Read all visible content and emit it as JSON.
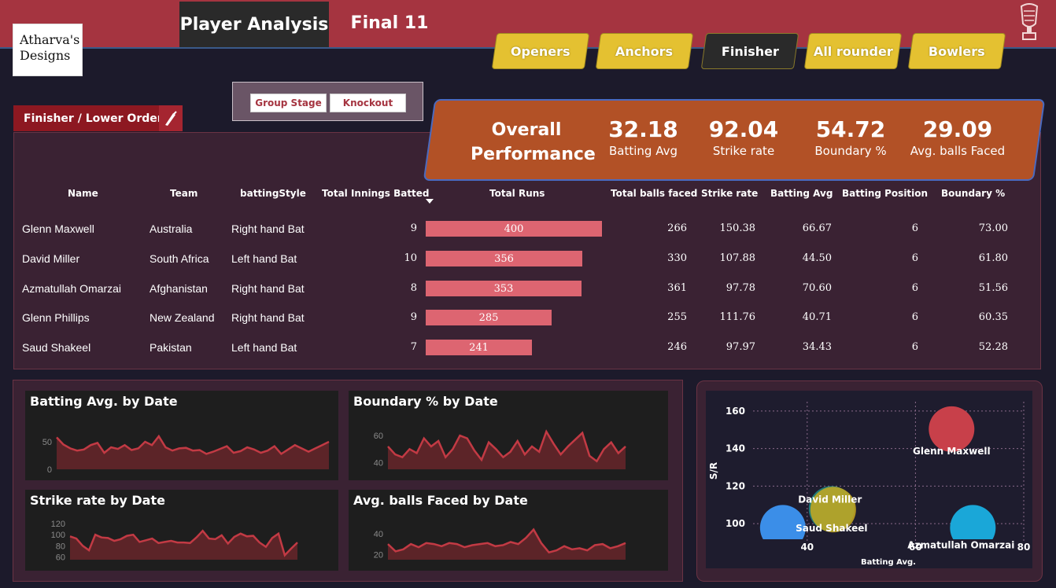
{
  "header": {
    "active_tab": "Player Analysis",
    "second_tab": "Final 11",
    "logo_text_line1": "Atharva's",
    "logo_text_line2": "Designs"
  },
  "nav": {
    "items": [
      {
        "label": "Openers",
        "active": false
      },
      {
        "label": "Anchors",
        "active": false
      },
      {
        "label": "Finisher",
        "active": true
      },
      {
        "label": "All rounder",
        "active": false
      },
      {
        "label": "Bowlers",
        "active": false
      }
    ]
  },
  "slicer": {
    "options": [
      "Group Stage",
      "Knockout"
    ]
  },
  "section_label": "Finisher / Lower Order",
  "kpi": {
    "title_line1": "Overall",
    "title_line2": "Performance",
    "items": [
      {
        "value": "32.18",
        "label": "Batting Avg"
      },
      {
        "value": "92.04",
        "label": "Strike rate"
      },
      {
        "value": "54.72",
        "label": "Boundary %"
      },
      {
        "value": "29.09",
        "label": "Avg. balls Faced"
      }
    ]
  },
  "table": {
    "columns": [
      "Name",
      "Team",
      "battingStyle",
      "Total Innings Batted",
      "Total Runs",
      "Total balls faced",
      "Strike rate",
      "Batting Avg",
      "Batting Position",
      "Boundary %"
    ],
    "rows": [
      {
        "name": "Glenn Maxwell",
        "team": "Australia",
        "style": "Right hand Bat",
        "innings": "9",
        "runs": 400,
        "balls": "266",
        "sr": "150.38",
        "avg": "66.67",
        "pos": "6",
        "boundary": "73.00"
      },
      {
        "name": "David Miller",
        "team": "South Africa",
        "style": "Left hand Bat",
        "innings": "10",
        "runs": 356,
        "balls": "330",
        "sr": "107.88",
        "avg": "44.50",
        "pos": "6",
        "boundary": "61.80"
      },
      {
        "name": "Azmatullah Omarzai",
        "team": "Afghanistan",
        "style": "Right hand Bat",
        "innings": "8",
        "runs": 353,
        "balls": "361",
        "sr": "97.78",
        "avg": "70.60",
        "pos": "6",
        "boundary": "51.56"
      },
      {
        "name": "Glenn Phillips",
        "team": "New Zealand",
        "style": "Right hand Bat",
        "innings": "9",
        "runs": 285,
        "balls": "255",
        "sr": "111.76",
        "avg": "40.71",
        "pos": "6",
        "boundary": "60.35"
      },
      {
        "name": "Saud Shakeel",
        "team": "Pakistan",
        "style": "Left hand Bat",
        "innings": "7",
        "runs": 241,
        "balls": "246",
        "sr": "97.97",
        "avg": "34.43",
        "pos": "6",
        "boundary": "52.28"
      }
    ],
    "runs_max": 400
  },
  "chart_data": [
    {
      "type": "area",
      "title": "Batting Avg. by Date",
      "ylim": [
        0,
        80
      ],
      "yticks": [
        "50",
        "0"
      ],
      "ytick_values": [
        50,
        0
      ],
      "values": [
        58,
        45,
        38,
        34,
        36,
        44,
        48,
        30,
        40,
        37,
        44,
        35,
        38,
        50,
        44,
        60,
        40,
        34,
        38,
        39,
        34,
        35,
        28,
        32,
        37,
        42,
        30,
        33,
        40,
        36,
        30,
        34,
        42,
        28,
        36,
        44,
        38,
        32,
        38,
        44,
        50
      ]
    },
    {
      "type": "area",
      "title": "Boundary % by Date",
      "ylim": [
        35,
        70
      ],
      "yticks": [
        "60",
        "40"
      ],
      "ytick_values": [
        60,
        40
      ],
      "values": [
        52,
        46,
        44,
        50,
        47,
        58,
        52,
        56,
        44,
        50,
        60,
        58,
        49,
        42,
        55,
        50,
        44,
        48,
        56,
        46,
        52,
        48,
        63,
        54,
        46,
        52,
        57,
        62,
        45,
        41,
        50,
        55,
        47,
        52
      ]
    },
    {
      "type": "area",
      "title": "Strike rate by Date",
      "ylim": [
        55,
        130
      ],
      "yticks": [
        "120",
        "100",
        "80",
        "60"
      ],
      "ytick_values": [
        120,
        100,
        80,
        60
      ],
      "values": [
        97,
        93,
        80,
        72,
        100,
        95,
        94,
        89,
        92,
        98,
        100,
        87,
        90,
        93,
        85,
        87,
        89,
        86,
        86,
        85,
        95,
        107,
        93,
        92,
        99,
        84,
        96,
        102,
        97,
        98,
        86,
        78,
        94,
        102,
        63,
        75,
        86
      ]
    },
    {
      "type": "area",
      "title": "Avg. balls Faced by Date",
      "ylim": [
        15,
        55
      ],
      "yticks": [
        "40",
        "20"
      ],
      "ytick_values": [
        40,
        20
      ],
      "values": [
        30,
        23,
        25,
        30,
        27,
        31,
        30,
        28,
        31,
        30,
        27,
        29,
        30,
        31,
        28,
        29,
        32,
        30,
        36,
        44,
        31,
        22,
        24,
        28,
        25,
        26,
        24,
        29,
        30,
        26,
        28,
        31
      ]
    },
    {
      "type": "scatter",
      "xlabel": "Batting Avg.",
      "ylabel": "S/R",
      "xlim": [
        30,
        80
      ],
      "ylim": [
        90,
        165
      ],
      "xticks": [
        40,
        60,
        80
      ],
      "yticks": [
        100,
        120,
        140,
        160
      ],
      "points": [
        {
          "name": "Glenn Maxwell",
          "x": 66.67,
          "y": 150.38,
          "color": "#c8404a"
        },
        {
          "name": "David Miller",
          "x": 44.5,
          "y": 107.88,
          "color": "#1e7a7a"
        },
        {
          "name": "Saud Shakeel",
          "x": 44.8,
          "y": 107.5,
          "color": "#c8a91e"
        },
        {
          "name": "Glenn Phillips",
          "x": 35.5,
          "y": 97.78,
          "color": "#3b8ee8"
        },
        {
          "name": "Azmatullah Omarzai",
          "x": 70.6,
          "y": 97.78,
          "color": "#1aa7d8"
        }
      ]
    }
  ]
}
